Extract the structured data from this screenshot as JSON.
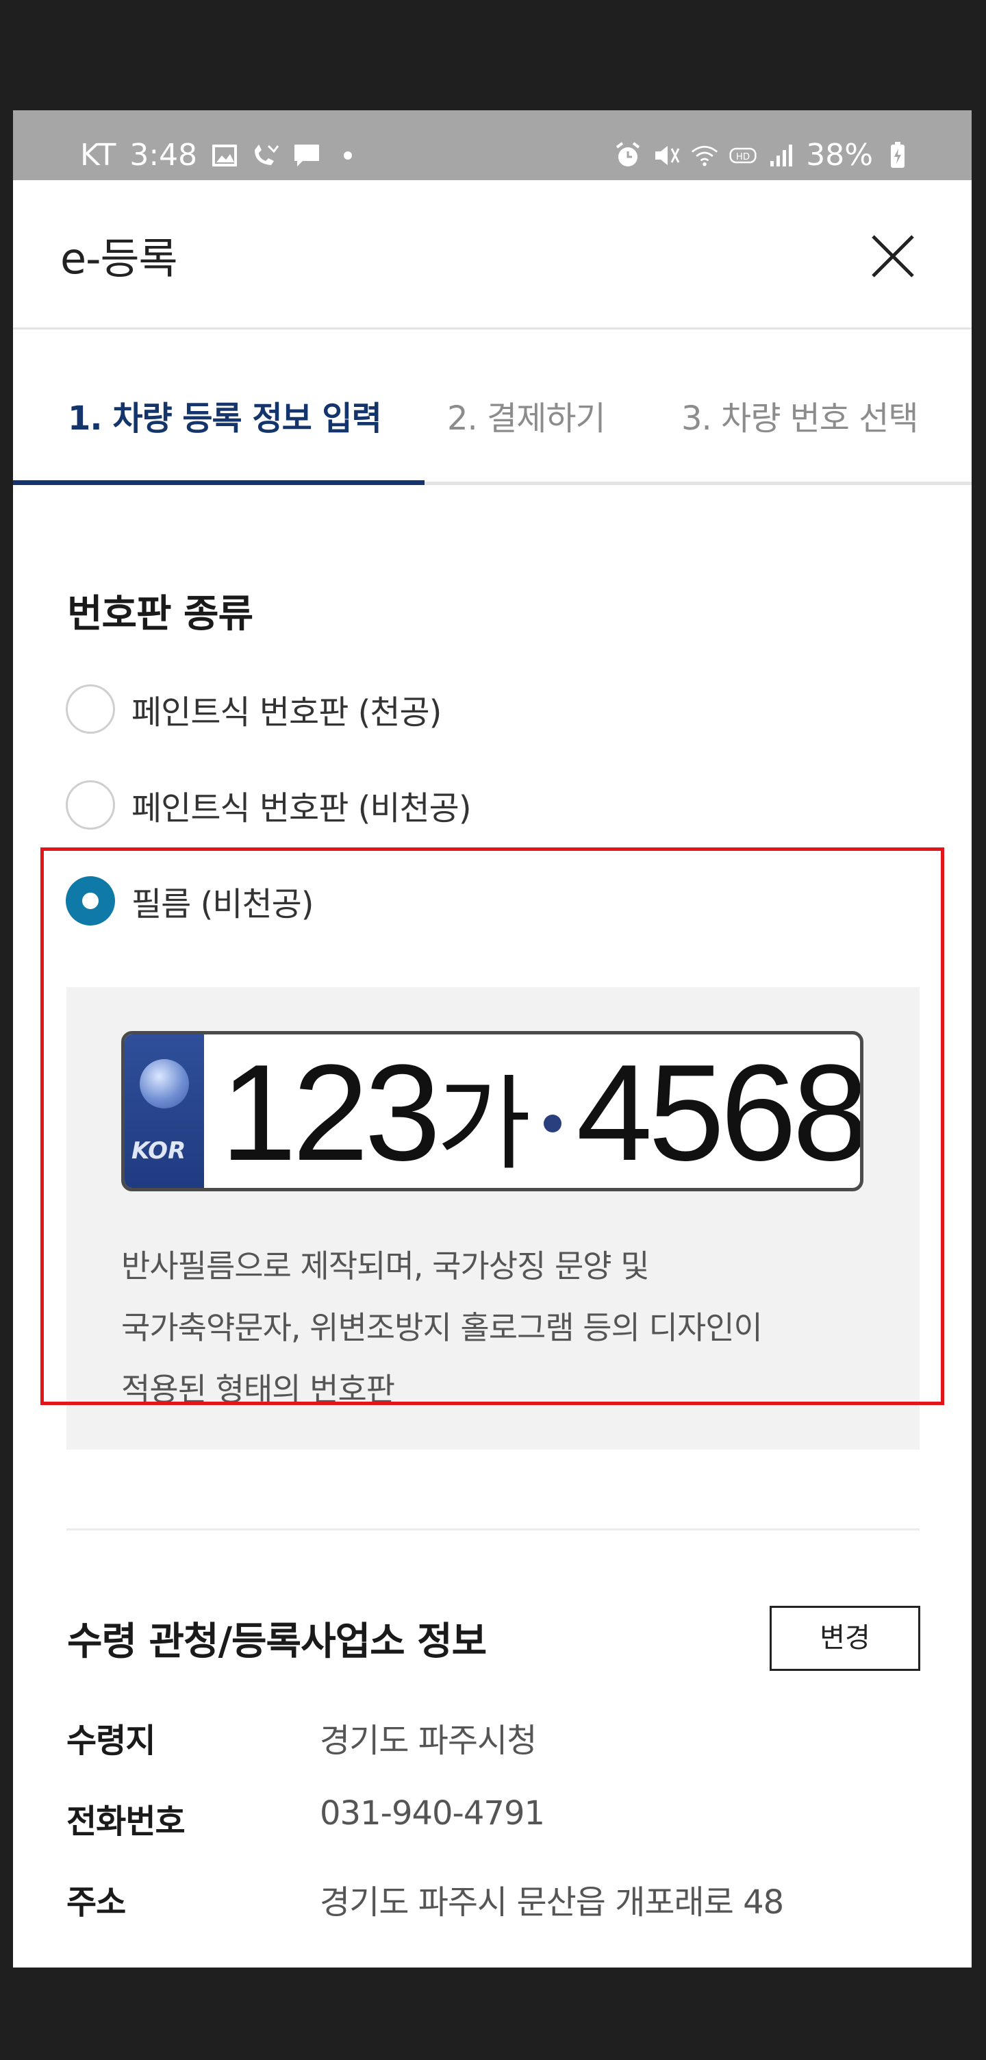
{
  "status_bar": {
    "carrier": "KT",
    "time": "3:48",
    "battery": "38%",
    "left_icons": [
      "image-icon",
      "missed-call-icon",
      "message-icon"
    ],
    "right_icons": [
      "alarm-icon",
      "mute-icon",
      "wifi-icon",
      "hd-icon",
      "signal-icon"
    ]
  },
  "header": {
    "title": "e-등록",
    "close_icon": "close-icon"
  },
  "steps": [
    {
      "label": "1. 차량 등록 정보 입력",
      "active": true
    },
    {
      "label": "2. 결제하기",
      "active": false
    },
    {
      "label": "3. 차량 번호 선택",
      "active": false
    }
  ],
  "plate_type": {
    "title": "번호판 종류",
    "options": [
      {
        "label": "페인트식 번호판 (천공)",
        "selected": false
      },
      {
        "label": "페인트식 번호판 (비천공)",
        "selected": false
      },
      {
        "label": "필름 (비천공)",
        "selected": true
      }
    ],
    "sample_plate": {
      "badge": "KOR",
      "front": "123",
      "korean": "가",
      "back": "4568"
    },
    "description_lines": [
      "반사필름으로 제작되며, 국가상징 문양 및",
      "국가축약문자, 위변조방지 홀로그램 등의 디자인이",
      "적용된 형태의 번호판"
    ]
  },
  "office_info": {
    "title": "수령 관청/등록사업소 정보",
    "change_button": "변경",
    "rows": [
      {
        "label": "수령지",
        "value": "경기도 파주시청"
      },
      {
        "label": "전화번호",
        "value": "031-940-4791"
      },
      {
        "label": "주소",
        "value": "경기도 파주시 문산읍 개포래로 48"
      }
    ]
  },
  "colors": {
    "accent": "#14356c",
    "radio_selected": "#0f7aa8",
    "highlight_border": "#e4151a",
    "status_bar": "#a6a6a6"
  }
}
